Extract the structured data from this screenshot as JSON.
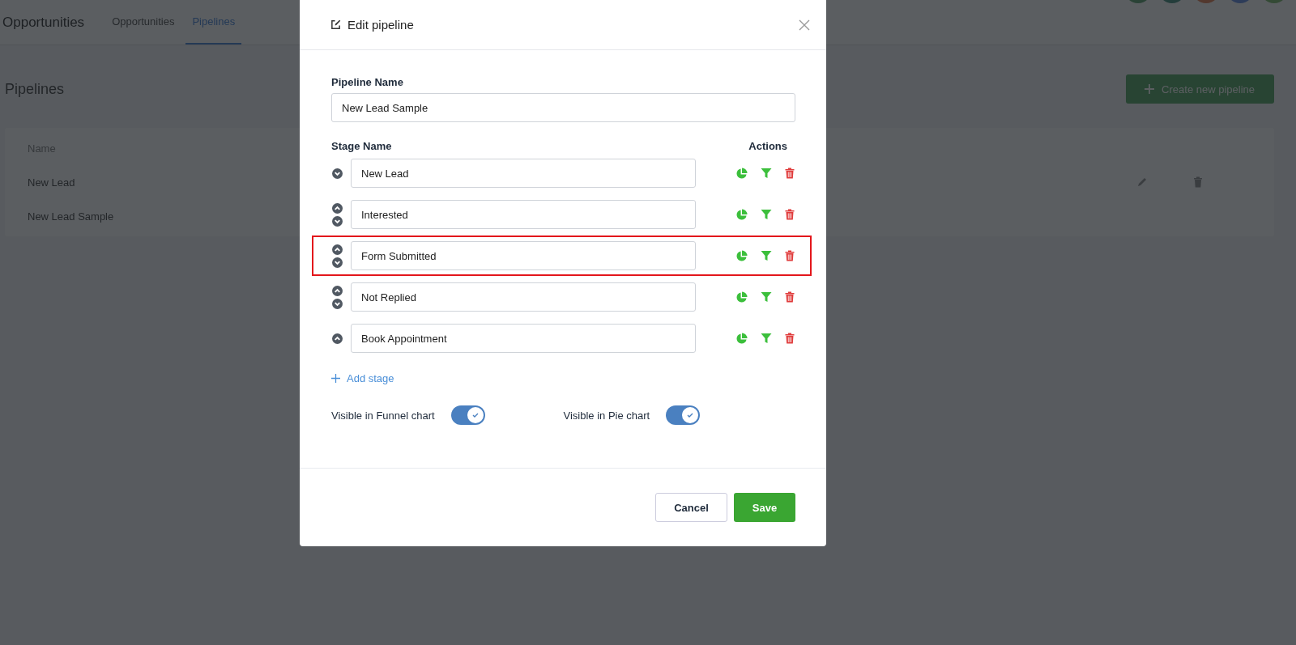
{
  "page": {
    "title": "Opportunities",
    "tabs": [
      {
        "label": "Opportunities",
        "selected": false
      },
      {
        "label": "Pipelines",
        "selected": true
      }
    ],
    "heading": "Pipelines",
    "create_button": "Create new pipeline",
    "table": {
      "columns": [
        "Name"
      ],
      "rows": [
        {
          "name": "New Lead",
          "kind": "editable"
        },
        {
          "name": "New Lead Sample",
          "kind": "plain"
        }
      ]
    }
  },
  "dialog": {
    "title": "Edit pipeline",
    "pipeline_name_label": "Pipeline Name",
    "pipeline_name": "New Lead Sample",
    "stage_label": "Stage Name",
    "actions_label": "Actions",
    "stages": [
      {
        "name": "New Lead",
        "can_move_up": false,
        "can_move_down": true,
        "highlighted": false
      },
      {
        "name": "Interested",
        "can_move_up": true,
        "can_move_down": true,
        "highlighted": false
      },
      {
        "name": "Form Submitted",
        "can_move_up": true,
        "can_move_down": true,
        "highlighted": true
      },
      {
        "name": "Not Replied",
        "can_move_up": true,
        "can_move_down": true,
        "highlighted": false
      },
      {
        "name": "Book Appointment",
        "can_move_up": true,
        "can_move_down": false,
        "highlighted": false
      }
    ],
    "add_stage": "Add stage",
    "toggles": [
      {
        "label": "Visible in Funnel chart",
        "on": true
      },
      {
        "label": "Visible in Pie chart",
        "on": true
      }
    ],
    "buttons": {
      "cancel": "Cancel",
      "save": "Save"
    }
  }
}
